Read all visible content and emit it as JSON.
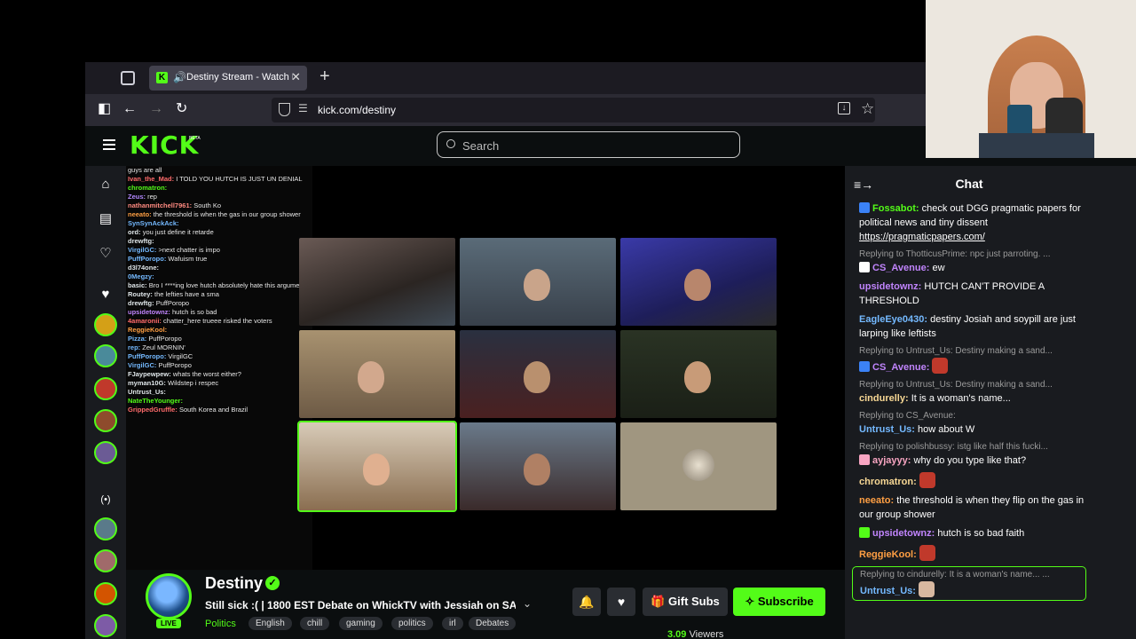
{
  "browser": {
    "tab_title": "Destiny Stream - Watch Live",
    "url": "kick.com/destiny",
    "colors": {
      "chrome_bg": "#1c1b22",
      "toolbar_bg": "#2b2a33",
      "accent": "#53fc18"
    }
  },
  "site": {
    "logo": "KICK",
    "beta": "BETA",
    "search_placeholder": "Search"
  },
  "overlay_chat": [
    {
      "name": "",
      "text": "guys are all",
      "color": "#e6e6e6"
    },
    {
      "name": "Ivan_the_Mad:",
      "text": "I TOLD YOU HUTCH IS JUST UN DENIAL",
      "color": "#ff6b6b"
    },
    {
      "name": "chromatron:",
      "text": "",
      "color": "#53fc18"
    },
    {
      "name": "Zeus:",
      "text": "rep",
      "color": "#b388ff"
    },
    {
      "name": "nathanmitchell7961:",
      "text": "South Ko",
      "color": "#ff8a80"
    },
    {
      "name": "neeato:",
      "text": "the threshold is when the gas in our group shower",
      "color": "#ff9f43"
    },
    {
      "name": "SynSynAckAck:",
      "text": "",
      "color": "#74b9ff"
    },
    {
      "name": "ord:",
      "text": "you just define it retarde",
      "color": "#dfe6e9"
    },
    {
      "name": "drewftg:",
      "text": "",
      "color": "#dfe6e9"
    },
    {
      "name": "VirgilGC:",
      "text": ">next chatter is impo",
      "color": "#74b9ff"
    },
    {
      "name": "PuffPoropo:",
      "text": "Wafuism true",
      "color": "#74b9ff"
    },
    {
      "name": "d3l74one:",
      "text": "",
      "color": "#dfe6e9"
    },
    {
      "name": "0Megzy:",
      "text": "",
      "color": "#74b9ff"
    },
    {
      "name": "basic:",
      "text": "Bro I ****ing love hutch absolutely hate this argument a",
      "color": "#dfe6e9"
    },
    {
      "name": "Routey:",
      "text": "the lefties have a sma",
      "color": "#dfe6e9"
    },
    {
      "name": "drewftg:",
      "text": "PuffPoropo",
      "color": "#dfe6e9"
    },
    {
      "name": "upsidetownz:",
      "text": "hutch is so bad",
      "color": "#c084fc"
    },
    {
      "name": "4amaronii:",
      "text": "chatter_here trueee risked the voters",
      "color": "#ff6b6b"
    },
    {
      "name": "ReggieKool:",
      "text": "",
      "color": "#ff9f43"
    },
    {
      "name": "Pizza:",
      "text": "PuffPoropo",
      "color": "#74b9ff"
    },
    {
      "name": "rep:",
      "text": "Zeul MORNIN'",
      "color": "#74b9ff"
    },
    {
      "name": "PuffPoropo:",
      "text": "VirgilGC",
      "color": "#74b9ff"
    },
    {
      "name": "VirgilGC:",
      "text": "PuffPoropo",
      "color": "#74b9ff"
    },
    {
      "name": "FJaypewpew:",
      "text": "whats the worst either?",
      "color": "#dfe6e9"
    },
    {
      "name": "myman10G:",
      "text": "Wildstep i respec",
      "color": "#dfe6e9"
    },
    {
      "name": "Untrust_Us:",
      "text": "",
      "color": "#dfe6e9"
    },
    {
      "name": "NateTheYounger:",
      "text": "",
      "color": "#53fc18"
    },
    {
      "name": "GrippedGruffle:",
      "text": "South Korea and Brazil",
      "color": "#ff6b6b"
    }
  ],
  "stream": {
    "name": "Destiny",
    "live": "LIVE",
    "title": "Still sick :( | 1800 EST Debate on WhickTV with Jessiah on SA...",
    "category": "Politics",
    "tags": [
      "English",
      "chill",
      "gaming",
      "politics",
      "irl",
      "Debates"
    ],
    "gift_label": "Gift Subs",
    "subscribe_label": "Subscribe",
    "viewers": "3.09",
    "viewers_label": "Viewers"
  },
  "chat": {
    "title": "Chat",
    "messages": [
      {
        "reply": "",
        "user": "Fossabot:",
        "user_color": "#53fc18",
        "text": "check out DGG pragmatic papers for political news and tiny dissent ",
        "link": "https://pragmaticpapers.com/"
      },
      {
        "reply": "Replying to ThotticusPrime: npc just parroting. ...",
        "user": "CS_Avenue:",
        "user_color": "#c084fc",
        "text": "ew",
        "link": ""
      },
      {
        "reply": "",
        "user": "upsidetownz:",
        "user_color": "#c084fc",
        "text": "HUTCH CAN'T PROVIDE A THRESHOLD",
        "link": ""
      },
      {
        "reply": "",
        "user": "EagleEye0430:",
        "user_color": "#74b9ff",
        "text": "destiny Josiah and soypill are just larping like leftists",
        "link": ""
      },
      {
        "reply": "Replying to Untrust_Us: Destiny making a sand...",
        "user": "CS_Avenue:",
        "user_color": "#c084fc",
        "text": "",
        "link": ""
      },
      {
        "reply": "Replying to Untrust_Us: Destiny making a sand...",
        "user": "cindurelly:",
        "user_color": "#f7d794",
        "text": "It is a woman's name...",
        "link": ""
      },
      {
        "reply": "Replying to CS_Avenue:",
        "user": "Untrust_Us:",
        "user_color": "#74b9ff",
        "text": "how about W",
        "link": ""
      },
      {
        "reply": "Replying to polishbussy: istg like half this fucki...",
        "user": "ayjayyy:",
        "user_color": "#f8a5c2",
        "text": "why do you type like that?",
        "link": ""
      },
      {
        "reply": "",
        "user": "chromatron:",
        "user_color": "#f7d794",
        "text": "",
        "link": ""
      },
      {
        "reply": "",
        "user": "neeato:",
        "user_color": "#ff9f43",
        "text": "the threshold is when they flip on the gas in our group shower",
        "link": ""
      },
      {
        "reply": "",
        "user": "upsidetownz:",
        "user_color": "#c084fc",
        "text": "hutch is so bad faith",
        "link": ""
      },
      {
        "reply": "",
        "user": "ReggieKool:",
        "user_color": "#ff9f43",
        "text": "",
        "link": ""
      }
    ],
    "highlight": {
      "reply": "Replying to cindurelly: It is a woman's name... ...",
      "user": "Untrust_Us:",
      "user_color": "#74b9ff"
    }
  }
}
